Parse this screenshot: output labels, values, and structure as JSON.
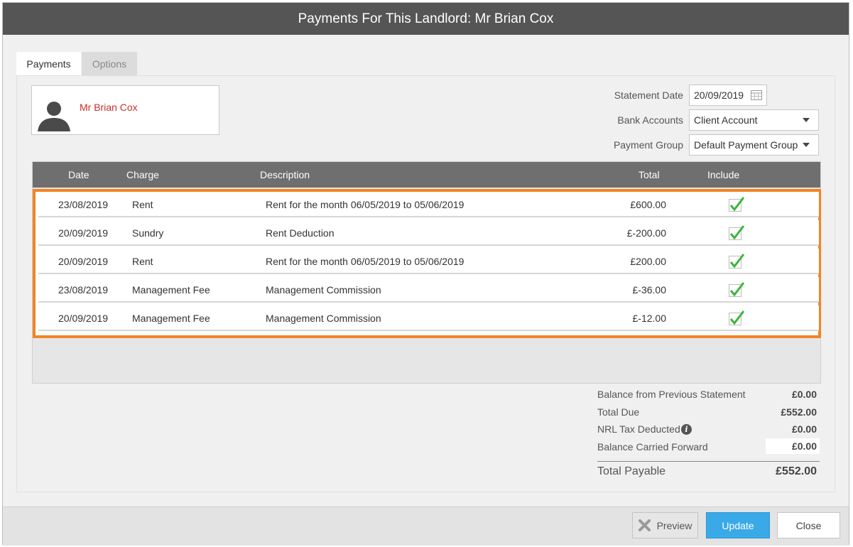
{
  "dialog": {
    "title": "Payments For This Landlord: Mr Brian Cox"
  },
  "tabs": [
    {
      "label": "Payments",
      "active": true
    },
    {
      "label": "Options",
      "active": false
    }
  ],
  "landlord": {
    "name": "Mr Brian Cox"
  },
  "form": {
    "statement_date_label": "Statement Date",
    "statement_date_value": "20/09/2019",
    "bank_accounts_label": "Bank Accounts",
    "bank_accounts_value": "Client Account",
    "payment_group_label": "Payment Group",
    "payment_group_value": "Default Payment Group"
  },
  "grid": {
    "headers": {
      "date": "Date",
      "charge": "Charge",
      "description": "Description",
      "total": "Total",
      "include": "Include"
    },
    "rows": [
      {
        "date": "23/08/2019",
        "charge": "Rent",
        "description": "Rent for the month 06/05/2019 to 05/06/2019",
        "total": "£600.00",
        "include": true
      },
      {
        "date": "20/09/2019",
        "charge": "Sundry",
        "description": "Rent Deduction",
        "total": "£-200.00",
        "include": true
      },
      {
        "date": "20/09/2019",
        "charge": "Rent",
        "description": "Rent for the month 06/05/2019 to 05/06/2019",
        "total": "£200.00",
        "include": true
      },
      {
        "date": "23/08/2019",
        "charge": "Management Fee",
        "description": "Management Commission",
        "total": "£-36.00",
        "include": true
      },
      {
        "date": "20/09/2019",
        "charge": "Management Fee",
        "description": "Management Commission",
        "total": "£-12.00",
        "include": true
      }
    ]
  },
  "summary": {
    "balance_prev_label": "Balance from Previous Statement",
    "balance_prev_value": "£0.00",
    "total_due_label": "Total Due",
    "total_due_value": "£552.00",
    "nrl_label": "NRL Tax Deducted",
    "nrl_value": "£0.00",
    "balance_cf_label": "Balance Carried Forward",
    "balance_cf_value": "£0.00",
    "total_payable_label": "Total Payable",
    "total_payable_value": "£552.00"
  },
  "buttons": {
    "preview": "Preview",
    "update": "Update",
    "close": "Close"
  },
  "colors": {
    "accent": "#3aa9e8",
    "highlight": "#f38425",
    "name_red": "#c8312b",
    "check_green": "#3cb53c"
  }
}
